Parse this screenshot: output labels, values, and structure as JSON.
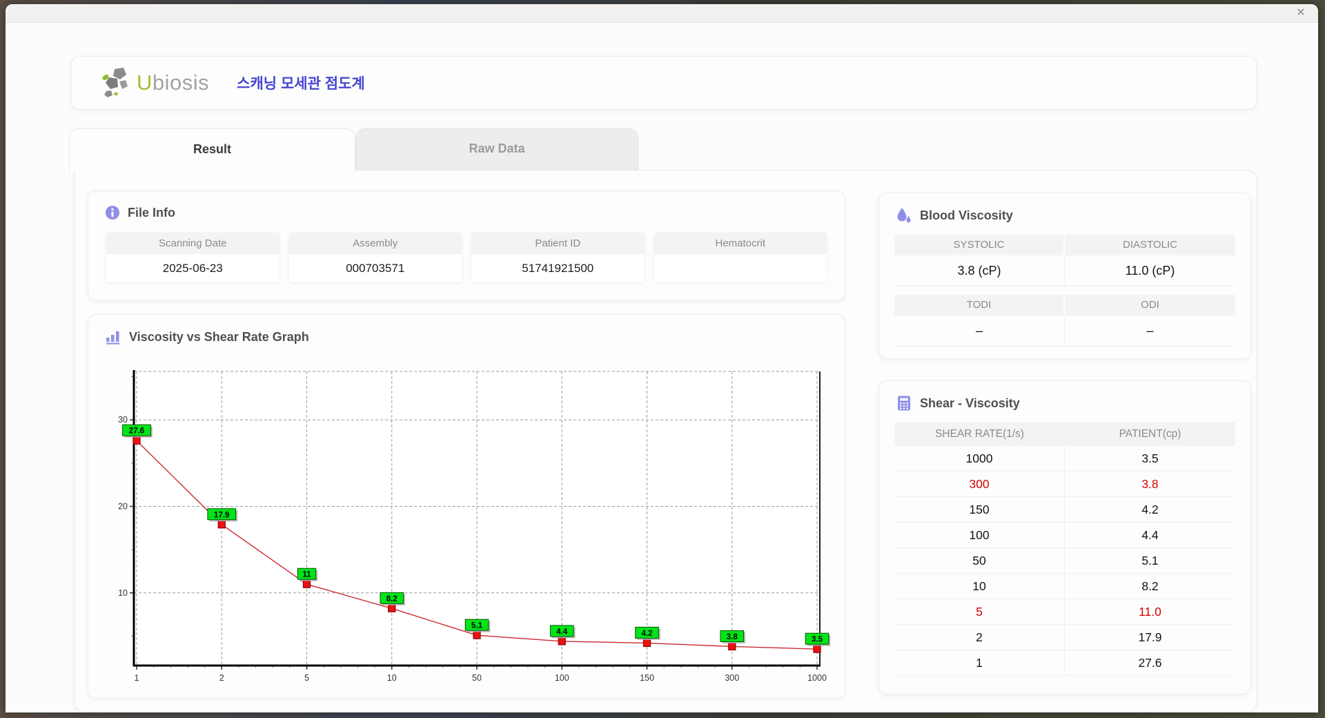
{
  "window": {
    "close_label": "✕"
  },
  "header": {
    "brand_prefix": "U",
    "brand_rest": "biosis",
    "app_title": "스캐닝 모세관 점도계"
  },
  "tabs": [
    {
      "label": "Result",
      "active": true
    },
    {
      "label": "Raw Data",
      "active": false
    }
  ],
  "file_info": {
    "title": "File Info",
    "fields": [
      {
        "label": "Scanning Date",
        "value": "2025-06-23"
      },
      {
        "label": "Assembly",
        "value": "000703571"
      },
      {
        "label": "Patient ID",
        "value": "51741921500"
      },
      {
        "label": "Hematocrit",
        "value": ""
      }
    ]
  },
  "blood_viscosity": {
    "title": "Blood Viscosity",
    "groups": [
      {
        "headers": [
          "SYSTOLIC",
          "DIASTOLIC"
        ],
        "values": [
          "3.8 (cP)",
          "11.0 (cP)"
        ]
      },
      {
        "headers": [
          "TODI",
          "ODI"
        ],
        "values": [
          "–",
          "–"
        ]
      }
    ]
  },
  "shear_viscosity": {
    "title": "Shear - Viscosity",
    "columns": [
      "SHEAR RATE(1/s)",
      "PATIENT(cp)"
    ],
    "rows": [
      {
        "rate": "1000",
        "patient": "3.5",
        "highlight": false
      },
      {
        "rate": "300",
        "patient": "3.8",
        "highlight": true
      },
      {
        "rate": "150",
        "patient": "4.2",
        "highlight": false
      },
      {
        "rate": "100",
        "patient": "4.4",
        "highlight": false
      },
      {
        "rate": "50",
        "patient": "5.1",
        "highlight": false
      },
      {
        "rate": "10",
        "patient": "8.2",
        "highlight": false
      },
      {
        "rate": "5",
        "patient": "11.0",
        "highlight": true
      },
      {
        "rate": "2",
        "patient": "17.9",
        "highlight": false
      },
      {
        "rate": "1",
        "patient": "27.6",
        "highlight": false
      }
    ]
  },
  "chart_data": {
    "type": "line",
    "title": "Viscosity vs Shear Rate Graph",
    "xlabel": "",
    "ylabel": "",
    "x_scale": "categorical",
    "categories": [
      1,
      2,
      5,
      10,
      50,
      100,
      150,
      300,
      1000
    ],
    "values": [
      27.6,
      17.9,
      11,
      8.2,
      5.1,
      4.4,
      4.2,
      3.8,
      3.5
    ],
    "point_labels": [
      "27.6",
      "17.9",
      "11",
      "8.2",
      "5.1",
      "4.4",
      "4.2",
      "3.8",
      "3.5"
    ],
    "y_ticks": [
      10,
      20,
      30
    ],
    "y_minor_ticks": [
      5,
      15,
      25,
      35
    ],
    "ylim": [
      1.6,
      35.6
    ],
    "grid": "dashed",
    "legend": "none",
    "line_color": "#cc2a33",
    "marker_color": "#ee1111",
    "marker_edge": "#8b0000",
    "label_bg": "#00e418",
    "label_border": "#005500",
    "axis_color": "#000000",
    "grid_color": "#999999"
  },
  "colors": {
    "brand_green": "#9bc234",
    "brand_gray": "#a2a2a2",
    "app_title_blue": "#4545d2",
    "icon_purple": "#8f8fea",
    "highlight_red": "#d40000"
  }
}
